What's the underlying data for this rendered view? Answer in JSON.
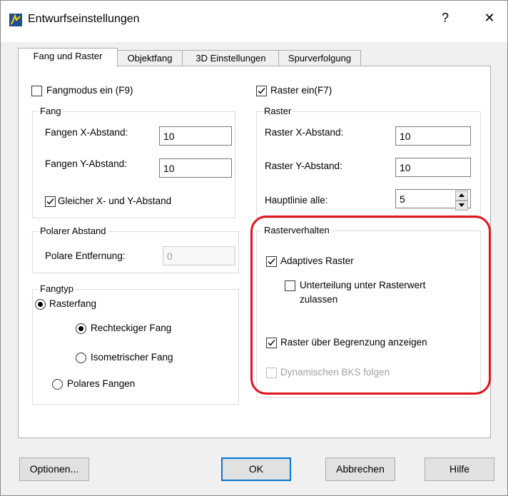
{
  "window": {
    "title": "Entwurfseinstellungen",
    "help_glyph": "?",
    "close_glyph": "✕"
  },
  "tabs": [
    {
      "label": "Fang und Raster",
      "active": true
    },
    {
      "label": "Objektfang"
    },
    {
      "label": "3D Einstellungen"
    },
    {
      "label": "Spurverfolgung"
    }
  ],
  "snap": {
    "mode_label": "Fangmodus ein (F9)",
    "mode_checked": false,
    "group_title": "Fang",
    "x_label": "Fangen X-Abstand:",
    "x_value": "10",
    "y_label": "Fangen Y-Abstand:",
    "y_value": "10",
    "equal_label": "Gleicher X- und Y-Abstand",
    "equal_checked": true
  },
  "polar": {
    "group_title": "Polarer Abstand",
    "distance_label": "Polare Entfernung:",
    "distance_value": "0"
  },
  "snap_type": {
    "group_title": "Fangtyp",
    "grid_snap": "Rasterfang",
    "rect_snap": "Rechteckiger Fang",
    "iso_snap": "Isometrischer Fang",
    "polar_snap": "Polares Fangen"
  },
  "grid": {
    "on_label": "Raster ein(F7)",
    "on_checked": true,
    "group_title": "Raster",
    "x_label": "Raster X-Abstand:",
    "x_value": "10",
    "y_label": "Raster Y-Abstand:",
    "y_value": "10",
    "major_label": "Hauptlinie alle:",
    "major_value": "5"
  },
  "behavior": {
    "group_title": "Rasterverhalten",
    "adaptive_label": "Adaptives Raster",
    "subdivide_label_1": "Unterteilung unter Rasterwert",
    "subdivide_label_2": "zulassen",
    "beyond_label": "Raster über Begrenzung anzeigen",
    "dynamic_label": "Dynamischen BKS folgen"
  },
  "buttons": {
    "options": "Optionen...",
    "ok": "OK",
    "cancel": "Abbrechen",
    "help": "Hilfe"
  },
  "colors": {
    "highlight": "#e0141e",
    "default_button_border": "#0078d7"
  }
}
